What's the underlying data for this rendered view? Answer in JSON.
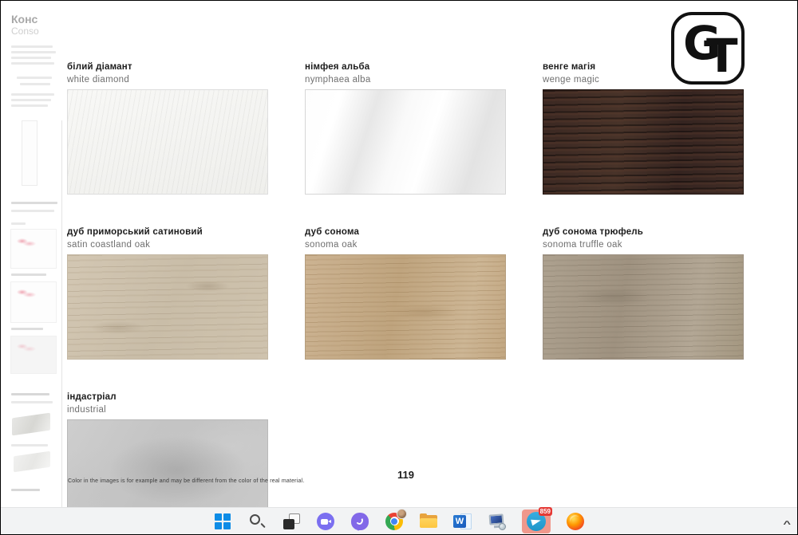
{
  "catalog": {
    "sidebar": {
      "heading_uk": "Конс",
      "heading_en": "Conso"
    },
    "logo": {
      "letter_g": "G",
      "letter_t": "T"
    },
    "materials": [
      {
        "name_uk": "білий діамант",
        "name_en": "white diamond"
      },
      {
        "name_uk": "німфея альба",
        "name_en": "nymphaea alba"
      },
      {
        "name_uk": "венге магія",
        "name_en": "wenge magic"
      },
      {
        "name_uk": "дуб приморський сатиновий",
        "name_en": "satin coastland oak"
      },
      {
        "name_uk": "дуб сонома",
        "name_en": "sonoma oak"
      },
      {
        "name_uk": "дуб сонома трюфель",
        "name_en": "sonoma truffle oak"
      },
      {
        "name_uk": "індастріал",
        "name_en": "industrial"
      }
    ],
    "swatch_colors": {
      "white_diamond": "#f3f3f1",
      "nymphaea_alba": "#f0f0f0",
      "wenge_magic": "#3b2822",
      "satin_coastland_oak": "#cbbfab",
      "sonoma_oak": "#c6ac8a",
      "sonoma_truffle_oak": "#a79b89",
      "industrial": "#c6c6c6"
    },
    "page_number": "119",
    "disclaimer": "Color in the images is for example and may be different from the color of the real material."
  },
  "taskbar": {
    "word_letter": "W",
    "telegram_badge": "859",
    "telegram_attention_color": "#f0988c",
    "badge_color": "#e53935",
    "tray_chevron": "^",
    "icons": [
      "windows-start",
      "search",
      "task-view",
      "chat-video",
      "viber",
      "chrome",
      "file-explorer",
      "word",
      "my-computer",
      "telegram",
      "firefox"
    ]
  }
}
